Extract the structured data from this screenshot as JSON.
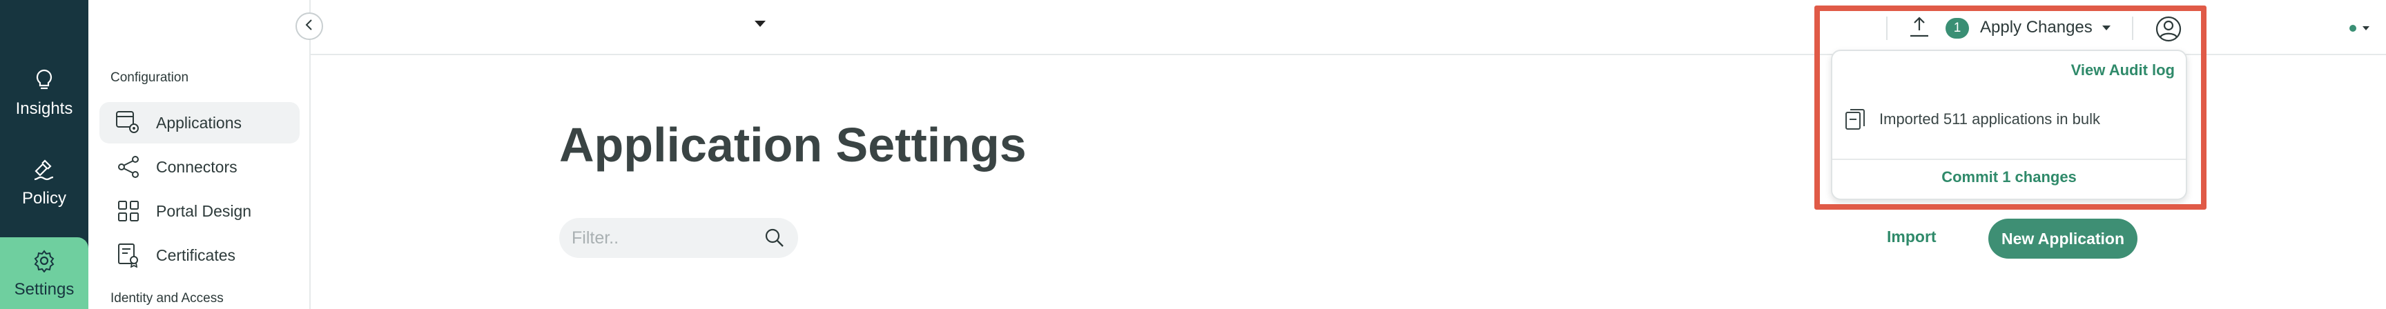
{
  "rail": {
    "items": [
      {
        "label": "Insights",
        "icon": "lightbulb-icon",
        "active": false
      },
      {
        "label": "Policy",
        "icon": "gavel-icon",
        "active": false
      },
      {
        "label": "Settings",
        "icon": "gear-icon",
        "active": true
      }
    ]
  },
  "sidebar": {
    "section_configuration": "Configuration",
    "items": [
      {
        "label": "Applications",
        "icon": "applications-gear-icon",
        "active": true
      },
      {
        "label": "Connectors",
        "icon": "share-nodes-icon",
        "active": false
      },
      {
        "label": "Portal Design",
        "icon": "grid-icon",
        "active": false
      },
      {
        "label": "Certificates",
        "icon": "certificate-icon",
        "active": false
      }
    ],
    "section_identity": "Identity and Access"
  },
  "topbar": {
    "pending_count": "1",
    "apply_label": "Apply Changes"
  },
  "changes_panel": {
    "audit_link": "View Audit log",
    "change_item": "Imported 511 applications in bulk",
    "commit_label": "Commit 1 changes"
  },
  "main": {
    "title": "Application Settings",
    "filter_placeholder": "Filter..",
    "import_label": "Import",
    "new_app_label": "New Application"
  },
  "colors": {
    "rail_bg": "#17353f",
    "accent": "#3e8f74",
    "active_rail": "#6fcf9f",
    "highlight": "#e05a47"
  }
}
